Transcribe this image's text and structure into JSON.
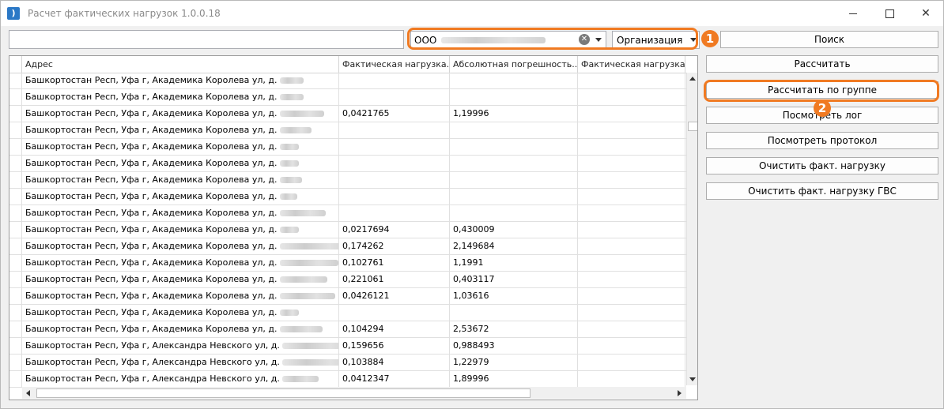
{
  "window": {
    "title": "Расчет фактических нагрузок 1.0.0.18",
    "icon": "app-signal-icon"
  },
  "toolbar": {
    "search_text_value": "",
    "org_value": "ООО",
    "search_type": "Организация",
    "search_label": "Поиск"
  },
  "badges": {
    "one": "1",
    "two": "2"
  },
  "accent_color": "#f07a22",
  "actions": [
    {
      "name": "calculate-button",
      "label": "Рассчитать"
    },
    {
      "name": "calculate-by-group-button",
      "label": "Рассчитать по группе"
    },
    {
      "name": "view-log-button",
      "label": "Посмотреть лог"
    },
    {
      "name": "view-protocol-button",
      "label": "Посмотреть протокол"
    },
    {
      "name": "clear-actual-load-button",
      "label": "Очистить факт. нагрузку"
    },
    {
      "name": "clear-actual-load-gvs-button",
      "label": "Очистить факт. нагрузку ГВС"
    }
  ],
  "grid": {
    "columns": [
      "Адрес",
      "Фактическая нагрузка...",
      "Абсолютная погрешность...",
      "Фактическая нагрузка..."
    ],
    "rows": [
      {
        "address": "Башкортостан Респ, Уфа г, Академика Королева ул, д.",
        "load": "",
        "error": "",
        "load2": ""
      },
      {
        "address": "Башкортостан Респ, Уфа г, Академика Королева ул, д.",
        "load": "",
        "error": "",
        "load2": ""
      },
      {
        "address": "Башкортостан Респ, Уфа г, Академика Королева ул, д.",
        "load": "0,0421765",
        "error": "1,19996",
        "load2": ""
      },
      {
        "address": "Башкортостан Респ, Уфа г, Академика Королева ул, д.",
        "load": "",
        "error": "",
        "load2": ""
      },
      {
        "address": "Башкортостан Респ, Уфа г, Академика Королева ул, д.",
        "load": "",
        "error": "",
        "load2": ""
      },
      {
        "address": "Башкортостан Респ, Уфа г, Академика Королева ул, д.",
        "load": "",
        "error": "",
        "load2": ""
      },
      {
        "address": "Башкортостан Респ, Уфа г, Академика Королева ул, д.",
        "load": "",
        "error": "",
        "load2": ""
      },
      {
        "address": "Башкортостан Респ, Уфа г, Академика Королева ул, д.",
        "load": "",
        "error": "",
        "load2": ""
      },
      {
        "address": "Башкортостан Респ, Уфа г, Академика Королева ул, д.",
        "load": "",
        "error": "",
        "load2": ""
      },
      {
        "address": "Башкортостан Респ, Уфа г, Академика Королева ул, д.",
        "load": "0,0217694",
        "error": "0,430009",
        "load2": ""
      },
      {
        "address": "Башкортостан Респ, Уфа г, Академика Королева ул, д.",
        "load": "0,174262",
        "error": "2,149684",
        "load2": ""
      },
      {
        "address": "Башкортостан Респ, Уфа г, Академика Королева ул, д.",
        "load": "0,102761",
        "error": "1,1991",
        "load2": ""
      },
      {
        "address": "Башкортостан Респ, Уфа г, Академика Королева ул, д.",
        "load": "0,221061",
        "error": "0,403117",
        "load2": ""
      },
      {
        "address": "Башкортостан Респ, Уфа г, Академика Королева ул, д.",
        "load": "0,0426121",
        "error": "1,03616",
        "load2": ""
      },
      {
        "address": "Башкортостан Респ, Уфа г, Академика Королева ул, д.",
        "load": "",
        "error": "",
        "load2": ""
      },
      {
        "address": "Башкортостан Респ, Уфа г, Академика Королева ул, д.",
        "load": "0,104294",
        "error": "2,53672",
        "load2": ""
      },
      {
        "address": "Башкортостан Респ, Уфа г, Александра Невского ул, д.",
        "load": "0,159656",
        "error": "0,988493",
        "load2": ""
      },
      {
        "address": "Башкортостан Респ, Уфа г, Александра Невского ул, д.",
        "load": "0,103884",
        "error": "1,22979",
        "load2": ""
      },
      {
        "address": "Башкортостан Респ, Уфа г, Александра Невского ул, д.",
        "load": "0,0412347",
        "error": "1,89996",
        "load2": ""
      }
    ]
  }
}
